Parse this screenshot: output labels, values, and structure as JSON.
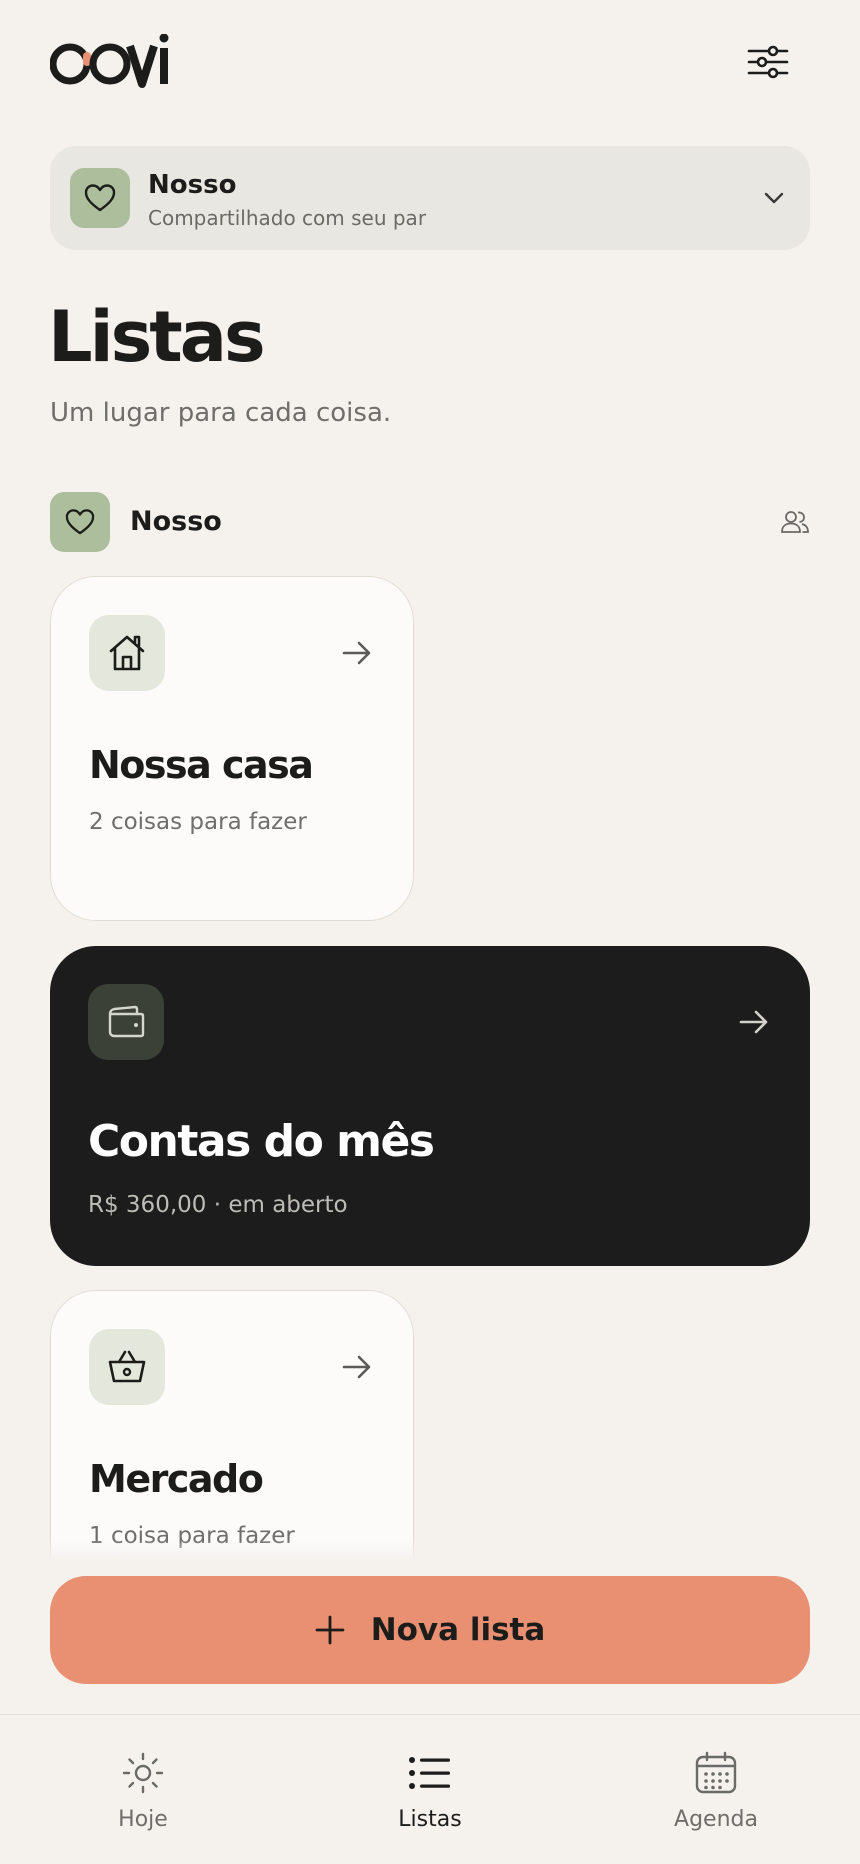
{
  "app": {
    "logo_text": "OOvi",
    "accent_color": "#e98f72",
    "dark_card_color": "#1b1c1b",
    "space_color": "#adbe9c"
  },
  "space_selector": {
    "name": "Nosso",
    "subtitle": "Compartilhado com seu par",
    "icon": "heart-icon"
  },
  "page": {
    "title": "Listas",
    "subtitle": "Um lugar para cada coisa."
  },
  "group": {
    "name": "Nosso",
    "icon": "heart-icon",
    "action_icon": "people-icon"
  },
  "lists": [
    {
      "title": "Nossa casa",
      "subtitle": "2 coisas para fazer",
      "icon": "house-icon",
      "style": "light"
    },
    {
      "title": "Contas do mês",
      "subtitle": "R$ 360,00 · em aberto",
      "icon": "wallet-icon",
      "style": "dark"
    },
    {
      "title": "Mercado",
      "subtitle": "1 coisa para fazer",
      "icon": "basket-icon",
      "style": "light"
    }
  ],
  "new_list_button": {
    "label": "Nova lista",
    "icon": "plus-icon"
  },
  "nav": [
    {
      "label": "Hoje",
      "icon": "sun-icon",
      "active": false
    },
    {
      "label": "Listas",
      "icon": "list-icon",
      "active": true
    },
    {
      "label": "Agenda",
      "icon": "calendar-icon",
      "active": false
    }
  ]
}
